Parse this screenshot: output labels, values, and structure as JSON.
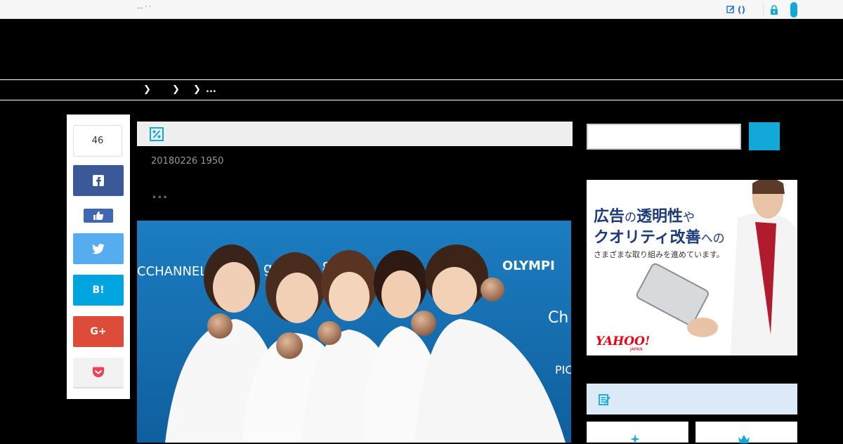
{
  "topbar": {
    "tagline": "... · ·",
    "edit_label": "()"
  },
  "breadcrumb": {
    "last": "..."
  },
  "share": {
    "count": "46",
    "facebook": "f",
    "hatena": "B!",
    "google": "G+"
  },
  "article": {
    "date": "20180226 1950",
    "lead": "...",
    "photo": {
      "backdrop_left": "CCHANNEL",
      "backdrop_mid": "gChang 8",
      "backdrop_right": "OLYMPI",
      "backdrop_ch": "Ch",
      "backdrop_pic": "PIC"
    }
  },
  "sidebar": {
    "ad": {
      "line1_big": "広告",
      "line1_small": "の",
      "line1_big2": "透明性",
      "line1_small2": "や",
      "line2_big": "クオリティ改善",
      "line2_small": "への",
      "line3": "さまざまな取り組みを進めています。",
      "logo": "YAHOO!",
      "logo_sub": "JAPAN"
    }
  },
  "colors": {
    "accent": "#12a8d8",
    "facebook": "#3b5998",
    "twitter": "#55acee",
    "hatena": "#00a4de",
    "google": "#dd4b39",
    "pocket": "#ef4056"
  }
}
